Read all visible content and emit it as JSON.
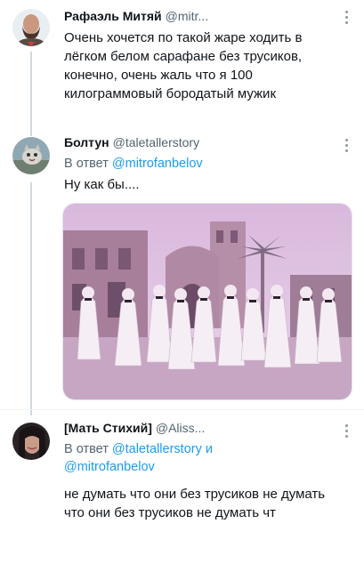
{
  "tweets": [
    {
      "name": "Рафаэль Митяй",
      "handle": "@mitr...",
      "text": "Очень хочется по такой жаре ходить в лёгком белом сарафане без трусиков, конечно, очень жаль что я 100 килограммовый бородатый мужик"
    },
    {
      "name": "Болтун",
      "handle": "@taletallerstory",
      "reply_prefix": "В ответ",
      "reply_handle": "@mitrofanbelov",
      "text": "Ну как бы...."
    },
    {
      "name": "[Мать Стихий]",
      "handle": "@Aliss...",
      "reply_prefix": "В ответ",
      "reply_handle": "@taletallerstory",
      "reply_joiner": "и",
      "reply_handle2": "@mitrofanbelov",
      "text": "не думать что они без трусиков не думать что они без трусиков не думать чт"
    }
  ],
  "icons": {
    "more": "more-vertical-icon"
  },
  "colors": {
    "link": "#1d9bf0",
    "secondary": "#536471",
    "thread_line": "#cfd9de"
  }
}
